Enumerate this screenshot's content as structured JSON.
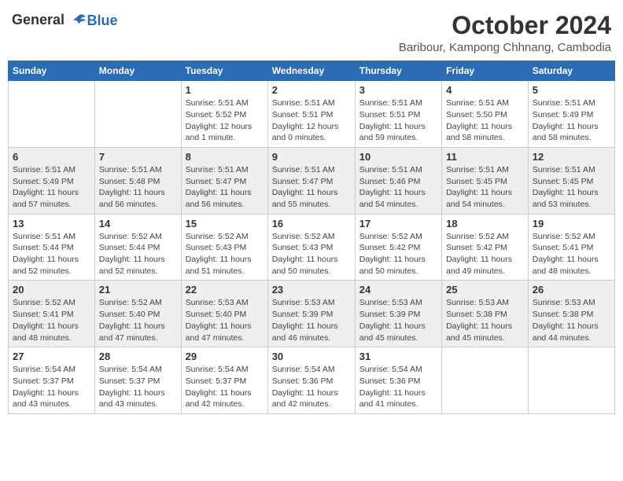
{
  "header": {
    "logo_general": "General",
    "logo_blue": "Blue",
    "month_title": "October 2024",
    "location": "Baribour, Kampong Chhnang, Cambodia"
  },
  "days_of_week": [
    "Sunday",
    "Monday",
    "Tuesday",
    "Wednesday",
    "Thursday",
    "Friday",
    "Saturday"
  ],
  "weeks": [
    [
      {
        "day": "",
        "info": ""
      },
      {
        "day": "",
        "info": ""
      },
      {
        "day": "1",
        "info": "Sunrise: 5:51 AM\nSunset: 5:52 PM\nDaylight: 12 hours\nand 1 minute."
      },
      {
        "day": "2",
        "info": "Sunrise: 5:51 AM\nSunset: 5:51 PM\nDaylight: 12 hours\nand 0 minutes."
      },
      {
        "day": "3",
        "info": "Sunrise: 5:51 AM\nSunset: 5:51 PM\nDaylight: 11 hours\nand 59 minutes."
      },
      {
        "day": "4",
        "info": "Sunrise: 5:51 AM\nSunset: 5:50 PM\nDaylight: 11 hours\nand 58 minutes."
      },
      {
        "day": "5",
        "info": "Sunrise: 5:51 AM\nSunset: 5:49 PM\nDaylight: 11 hours\nand 58 minutes."
      }
    ],
    [
      {
        "day": "6",
        "info": "Sunrise: 5:51 AM\nSunset: 5:49 PM\nDaylight: 11 hours\nand 57 minutes."
      },
      {
        "day": "7",
        "info": "Sunrise: 5:51 AM\nSunset: 5:48 PM\nDaylight: 11 hours\nand 56 minutes."
      },
      {
        "day": "8",
        "info": "Sunrise: 5:51 AM\nSunset: 5:47 PM\nDaylight: 11 hours\nand 56 minutes."
      },
      {
        "day": "9",
        "info": "Sunrise: 5:51 AM\nSunset: 5:47 PM\nDaylight: 11 hours\nand 55 minutes."
      },
      {
        "day": "10",
        "info": "Sunrise: 5:51 AM\nSunset: 5:46 PM\nDaylight: 11 hours\nand 54 minutes."
      },
      {
        "day": "11",
        "info": "Sunrise: 5:51 AM\nSunset: 5:45 PM\nDaylight: 11 hours\nand 54 minutes."
      },
      {
        "day": "12",
        "info": "Sunrise: 5:51 AM\nSunset: 5:45 PM\nDaylight: 11 hours\nand 53 minutes."
      }
    ],
    [
      {
        "day": "13",
        "info": "Sunrise: 5:51 AM\nSunset: 5:44 PM\nDaylight: 11 hours\nand 52 minutes."
      },
      {
        "day": "14",
        "info": "Sunrise: 5:52 AM\nSunset: 5:44 PM\nDaylight: 11 hours\nand 52 minutes."
      },
      {
        "day": "15",
        "info": "Sunrise: 5:52 AM\nSunset: 5:43 PM\nDaylight: 11 hours\nand 51 minutes."
      },
      {
        "day": "16",
        "info": "Sunrise: 5:52 AM\nSunset: 5:43 PM\nDaylight: 11 hours\nand 50 minutes."
      },
      {
        "day": "17",
        "info": "Sunrise: 5:52 AM\nSunset: 5:42 PM\nDaylight: 11 hours\nand 50 minutes."
      },
      {
        "day": "18",
        "info": "Sunrise: 5:52 AM\nSunset: 5:42 PM\nDaylight: 11 hours\nand 49 minutes."
      },
      {
        "day": "19",
        "info": "Sunrise: 5:52 AM\nSunset: 5:41 PM\nDaylight: 11 hours\nand 48 minutes."
      }
    ],
    [
      {
        "day": "20",
        "info": "Sunrise: 5:52 AM\nSunset: 5:41 PM\nDaylight: 11 hours\nand 48 minutes."
      },
      {
        "day": "21",
        "info": "Sunrise: 5:52 AM\nSunset: 5:40 PM\nDaylight: 11 hours\nand 47 minutes."
      },
      {
        "day": "22",
        "info": "Sunrise: 5:53 AM\nSunset: 5:40 PM\nDaylight: 11 hours\nand 47 minutes."
      },
      {
        "day": "23",
        "info": "Sunrise: 5:53 AM\nSunset: 5:39 PM\nDaylight: 11 hours\nand 46 minutes."
      },
      {
        "day": "24",
        "info": "Sunrise: 5:53 AM\nSunset: 5:39 PM\nDaylight: 11 hours\nand 45 minutes."
      },
      {
        "day": "25",
        "info": "Sunrise: 5:53 AM\nSunset: 5:38 PM\nDaylight: 11 hours\nand 45 minutes."
      },
      {
        "day": "26",
        "info": "Sunrise: 5:53 AM\nSunset: 5:38 PM\nDaylight: 11 hours\nand 44 minutes."
      }
    ],
    [
      {
        "day": "27",
        "info": "Sunrise: 5:54 AM\nSunset: 5:37 PM\nDaylight: 11 hours\nand 43 minutes."
      },
      {
        "day": "28",
        "info": "Sunrise: 5:54 AM\nSunset: 5:37 PM\nDaylight: 11 hours\nand 43 minutes."
      },
      {
        "day": "29",
        "info": "Sunrise: 5:54 AM\nSunset: 5:37 PM\nDaylight: 11 hours\nand 42 minutes."
      },
      {
        "day": "30",
        "info": "Sunrise: 5:54 AM\nSunset: 5:36 PM\nDaylight: 11 hours\nand 42 minutes."
      },
      {
        "day": "31",
        "info": "Sunrise: 5:54 AM\nSunset: 5:36 PM\nDaylight: 11 hours\nand 41 minutes."
      },
      {
        "day": "",
        "info": ""
      },
      {
        "day": "",
        "info": ""
      }
    ]
  ]
}
